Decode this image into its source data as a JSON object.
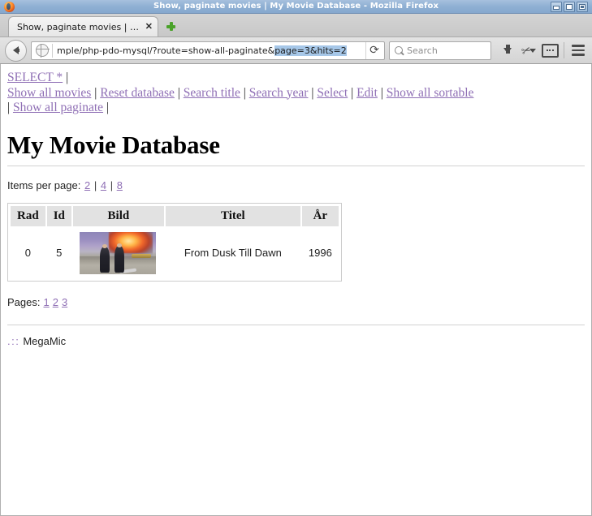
{
  "window": {
    "title": "Show, paginate movies | My Movie Database - Mozilla Firefox",
    "controls": {
      "minimize": "_",
      "maximize": "□",
      "close": "X"
    }
  },
  "tabs": [
    {
      "label": "Show, paginate movies | My...",
      "close_label": "✕"
    }
  ],
  "newtab_label": "+",
  "toolbar": {
    "back_label": "Back",
    "url_prefix": "mple/php-pdo-mysql/?route=show-all-paginate&",
    "url_selected": "page=3&hits=2",
    "reload_glyph": "⟳",
    "search_placeholder": "Search",
    "download_label": "Downloads",
    "clip_glyph": "✂",
    "chevron_label": "More tools",
    "reader_label": "Reader view",
    "menu_label": "Open menu"
  },
  "page": {
    "nav": {
      "line1": [
        {
          "text": "SELECT *",
          "type": "link"
        },
        {
          "text": "|",
          "type": "sep"
        }
      ],
      "line2": [
        {
          "text": "Show all movies",
          "type": "link"
        },
        {
          "text": "|",
          "type": "sep"
        },
        {
          "text": "Reset database",
          "type": "link"
        },
        {
          "text": "|",
          "type": "sep"
        },
        {
          "text": "Search title",
          "type": "link"
        },
        {
          "text": "|",
          "type": "sep"
        },
        {
          "text": "Search year",
          "type": "link"
        },
        {
          "text": "|",
          "type": "sep"
        },
        {
          "text": "Select",
          "type": "link"
        },
        {
          "text": "|",
          "type": "sep"
        },
        {
          "text": "Edit",
          "type": "link"
        },
        {
          "text": "|",
          "type": "sep"
        },
        {
          "text": "Show all sortable",
          "type": "link"
        }
      ],
      "line3": [
        {
          "text": "|",
          "type": "sep"
        },
        {
          "text": "Show all paginate",
          "type": "link"
        },
        {
          "text": "|",
          "type": "sep"
        }
      ]
    },
    "title": "My Movie Database",
    "items_per_page": {
      "label": "Items per page:",
      "options": [
        "2",
        "4",
        "8"
      ],
      "separator": "|"
    },
    "table": {
      "headers": [
        "Rad",
        "Id",
        "Bild",
        "Titel",
        "År"
      ],
      "rows": [
        {
          "rad": "0",
          "id": "5",
          "bild_alt": "movie-thumbnail",
          "titel": "From Dusk Till Dawn",
          "ar": "1996"
        }
      ]
    },
    "pagination": {
      "label": "Pages:",
      "pages": [
        "1",
        "2",
        "3"
      ]
    },
    "footer": {
      "dots": ".::",
      "text": "MegaMic"
    }
  },
  "colors": {
    "link": "#8f6fb5",
    "titlebar_start": "#a6c0de",
    "titlebar_end": "#85a8ce",
    "url_selection": "#a6c7e8",
    "table_header_bg": "#e2e2e2"
  }
}
